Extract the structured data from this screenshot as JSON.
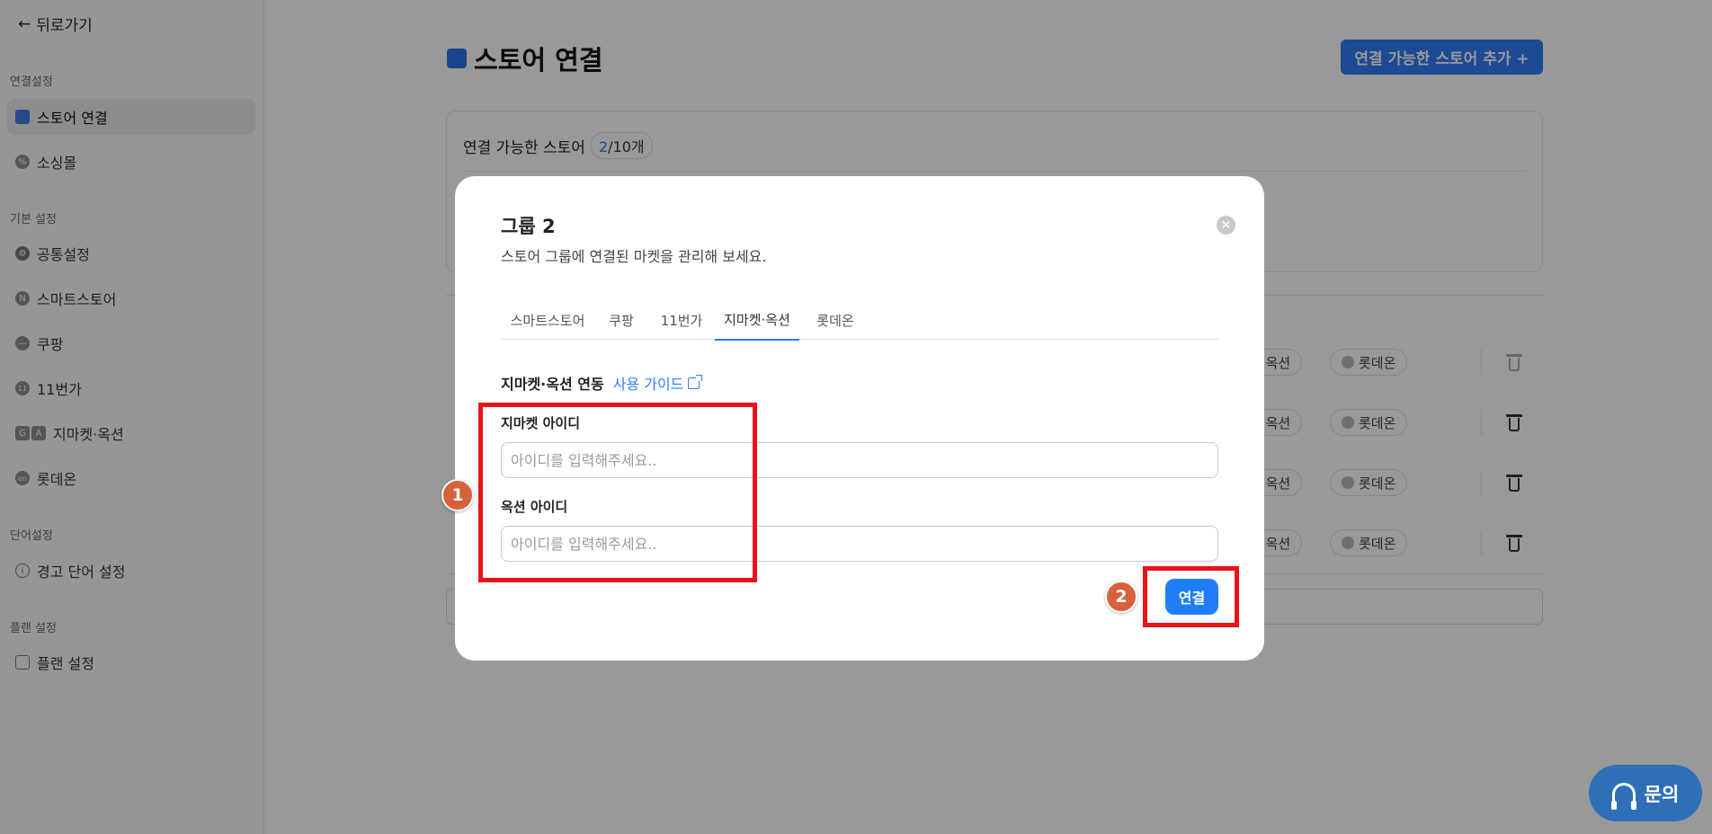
{
  "sidebar": {
    "back_label": "뒤로가기",
    "sections": [
      {
        "label": "연결설정"
      },
      {
        "label": "기본 설정"
      },
      {
        "label": "단어설정"
      },
      {
        "label": "플랜 설정"
      }
    ],
    "items": [
      {
        "label": "스토어 연결"
      },
      {
        "label": "소싱몰"
      },
      {
        "label": "공통설정"
      },
      {
        "label": "스마트스토어"
      },
      {
        "label": "쿠팡"
      },
      {
        "label": "11번가"
      },
      {
        "label": "지마켓·옥션"
      },
      {
        "label": "롯데온"
      },
      {
        "label": "경고 단어 설정"
      },
      {
        "label": "플랜 설정"
      }
    ]
  },
  "main": {
    "title": "스토어 연결",
    "add_store_label": "연결 가능한 스토어 추가 +",
    "card": {
      "label": "연결 가능한 스토어",
      "count_current": "2",
      "count_total": "/10개"
    },
    "rows": [
      {
        "market1": "켓·옥션",
        "market2": "롯데온"
      },
      {
        "market1": "켓·옥션",
        "market2": "롯데온"
      },
      {
        "market1": "켓·옥션",
        "market2": "롯데온"
      },
      {
        "market1": "켓·옥션",
        "market2": "롯데온"
      }
    ]
  },
  "modal": {
    "title": "그룹 2",
    "subtitle": "스토어 그룹에 연결된 마켓을 관리해 보세요.",
    "tabs": [
      {
        "label": "스마트스토어"
      },
      {
        "label": "쿠팡"
      },
      {
        "label": "11번가"
      },
      {
        "label": "지마켓·옥션"
      },
      {
        "label": "롯데온"
      }
    ],
    "active_tab": "지마켓·옥션",
    "section_title": "지마켓·옥션 연동",
    "guide_label": "사용 가이드",
    "gmarket_label": "지마켓 아이디",
    "gmarket_placeholder": "아이디를 입력해주세요..",
    "auction_label": "옥션 아이디",
    "auction_placeholder": "아이디를 입력해주세요..",
    "connect_label": "연결"
  },
  "annotations": {
    "step1": "1",
    "step2": "2",
    "box_color": "#e8141b",
    "badge_color": "#d7613b"
  },
  "inquiry_label": "문의",
  "colors": {
    "accent": "#2f7cf6",
    "inquiry_bg": "#2e6fb8"
  }
}
